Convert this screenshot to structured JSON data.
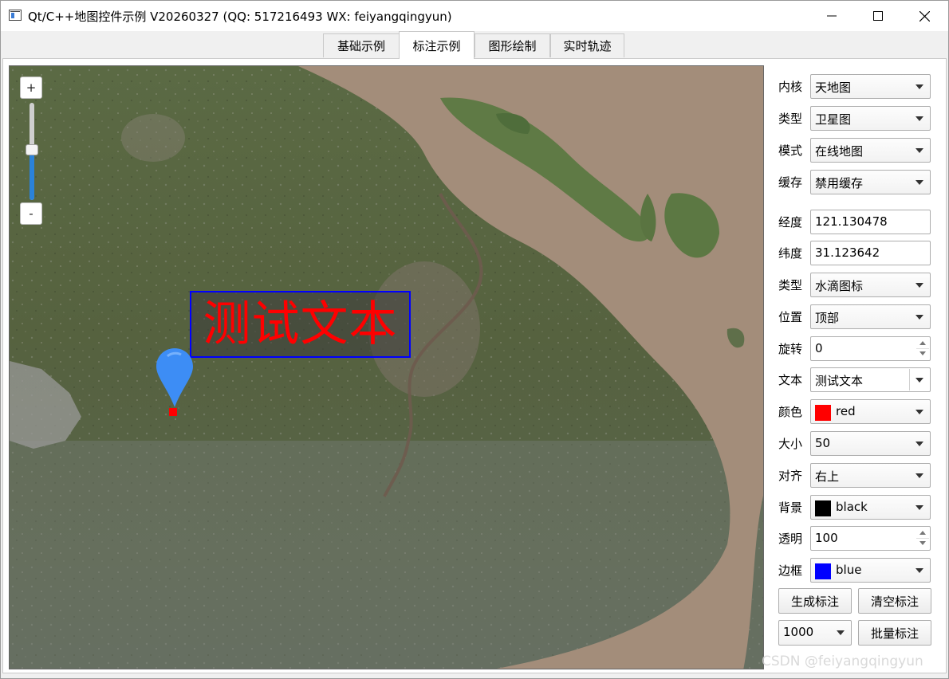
{
  "window": {
    "title": "Qt/C++地图控件示例 V20260327 (QQ: 517216493 WX: feiyangqingyun)"
  },
  "tabs": [
    {
      "label": "基础示例",
      "active": false
    },
    {
      "label": "标注示例",
      "active": true
    },
    {
      "label": "图形绘制",
      "active": false
    },
    {
      "label": "实时轨迹",
      "active": false
    }
  ],
  "map": {
    "zoom_in_label": "+",
    "zoom_out_label": "-",
    "zoom_level_fraction": 0.55,
    "marker_text": "测试文本",
    "marker_text_color": "#ff0000",
    "marker_border_color": "#0000ff"
  },
  "panel": {
    "kernel": {
      "label": "内核",
      "value": "天地图"
    },
    "map_type": {
      "label": "类型",
      "value": "卫星图"
    },
    "mode": {
      "label": "模式",
      "value": "在线地图"
    },
    "cache": {
      "label": "缓存",
      "value": "禁用缓存"
    },
    "longitude": {
      "label": "经度",
      "value": "121.130478"
    },
    "latitude": {
      "label": "纬度",
      "value": "31.123642"
    },
    "marker_type": {
      "label": "类型",
      "value": "水滴图标"
    },
    "position": {
      "label": "位置",
      "value": "顶部"
    },
    "rotation": {
      "label": "旋转",
      "value": "0"
    },
    "text": {
      "label": "文本",
      "value": "测试文本"
    },
    "color": {
      "label": "颜色",
      "value": "red",
      "swatch": "#ff0000"
    },
    "size": {
      "label": "大小",
      "value": "50"
    },
    "align": {
      "label": "对齐",
      "value": "右上"
    },
    "background": {
      "label": "背景",
      "value": "black",
      "swatch": "#000000"
    },
    "opacity": {
      "label": "透明",
      "value": "100"
    },
    "border": {
      "label": "边框",
      "value": "blue",
      "swatch": "#0000ff"
    },
    "generate_button": "生成标注",
    "clear_button": "清空标注",
    "batch_count": "1000",
    "batch_button": "批量标注"
  },
  "watermark": "CSDN @feiyangqingyun"
}
